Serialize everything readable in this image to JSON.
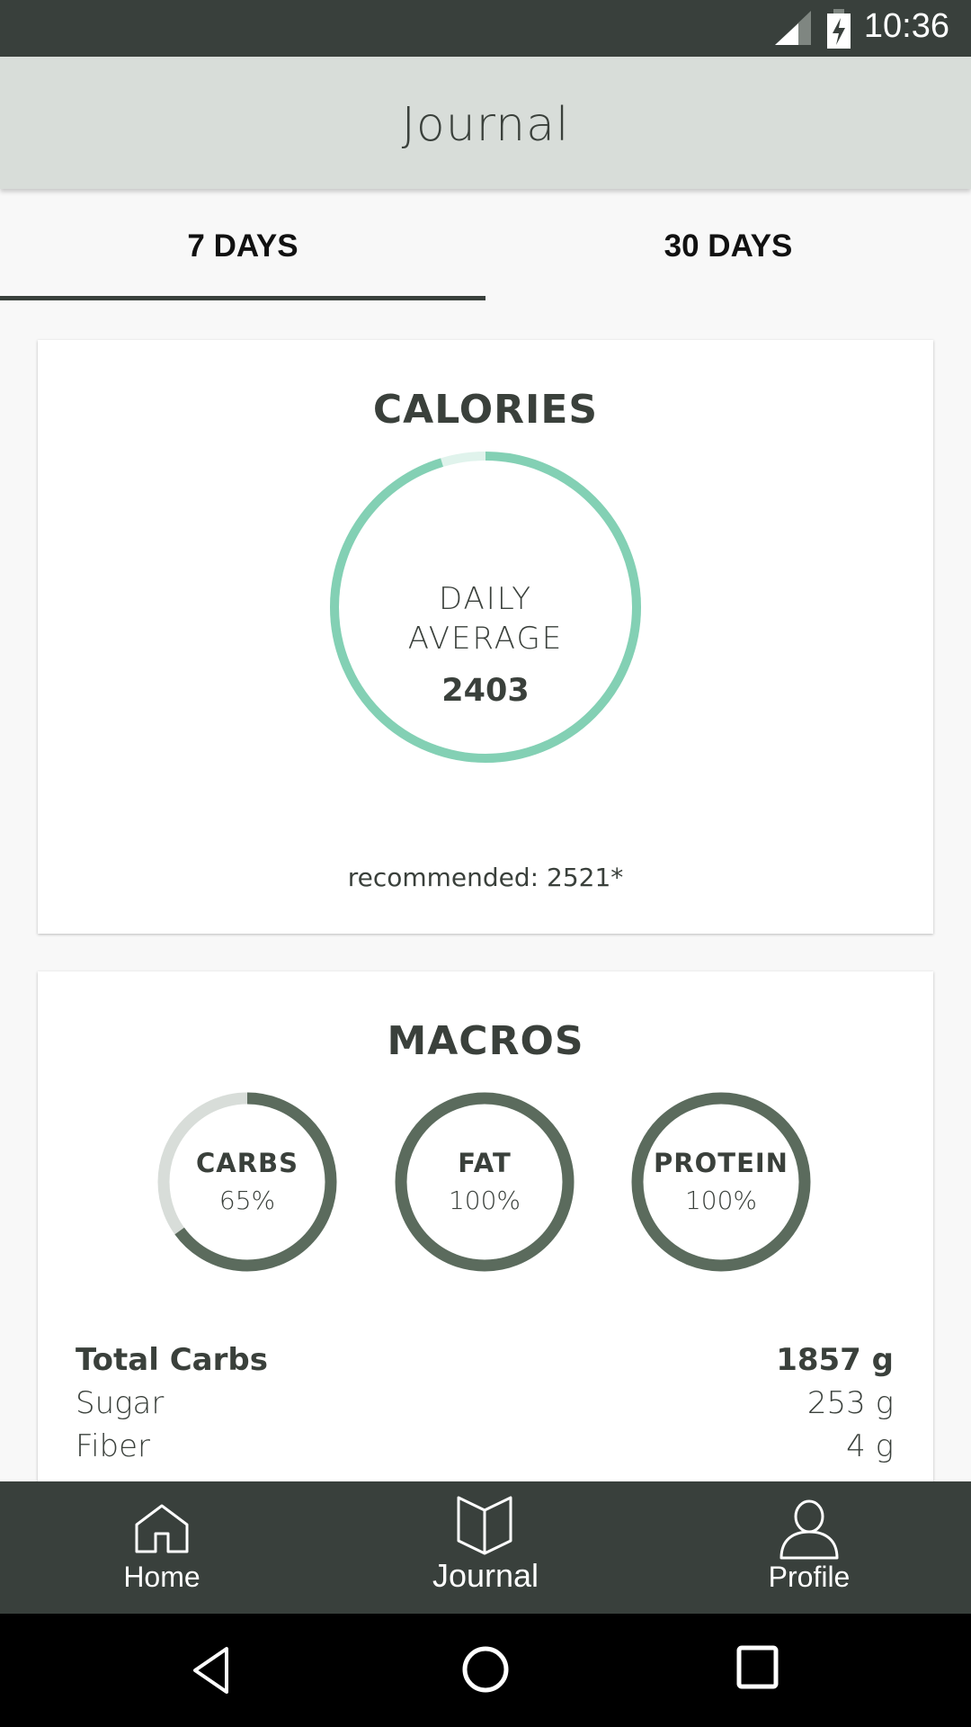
{
  "status_bar": {
    "time": "10:36",
    "icons": [
      "signal-icon",
      "battery-charging-icon"
    ]
  },
  "app_bar": {
    "title": "Journal"
  },
  "tabs": [
    {
      "label": "7 DAYS",
      "selected": true
    },
    {
      "label": "30 DAYS",
      "selected": false
    }
  ],
  "calories": {
    "title": "CALORIES",
    "ring_label_1": "DAILY",
    "ring_label_2": "AVERAGE",
    "value": "2403",
    "recommended": "recommended: 2521*",
    "progress_fraction": 0.953,
    "color": "#83d0b4",
    "track_color": "#e0f3ec"
  },
  "macros": {
    "title": "MACROS",
    "color": "#5b6b5d",
    "track_color": "#d8ddd9",
    "rings": [
      {
        "label": "CARBS",
        "percent_text": "65%",
        "fraction": 0.65
      },
      {
        "label": "FAT",
        "percent_text": "100%",
        "fraction": 1.0
      },
      {
        "label": "PROTEIN",
        "percent_text": "100%",
        "fraction": 1.0
      }
    ],
    "rows": [
      {
        "label": "Total Carbs",
        "value": "1857 g",
        "bold": true
      },
      {
        "label": "Sugar",
        "value": "253 g",
        "bold": false
      },
      {
        "label": "Fiber",
        "value": "4 g",
        "bold": false
      }
    ]
  },
  "bottom_nav": [
    {
      "label": "Home",
      "icon": "home-icon"
    },
    {
      "label": "Journal",
      "icon": "book-icon",
      "active": true
    },
    {
      "label": "Profile",
      "icon": "person-icon"
    }
  ],
  "system_nav": [
    "back-icon",
    "home-circle-icon",
    "recents-icon"
  ]
}
